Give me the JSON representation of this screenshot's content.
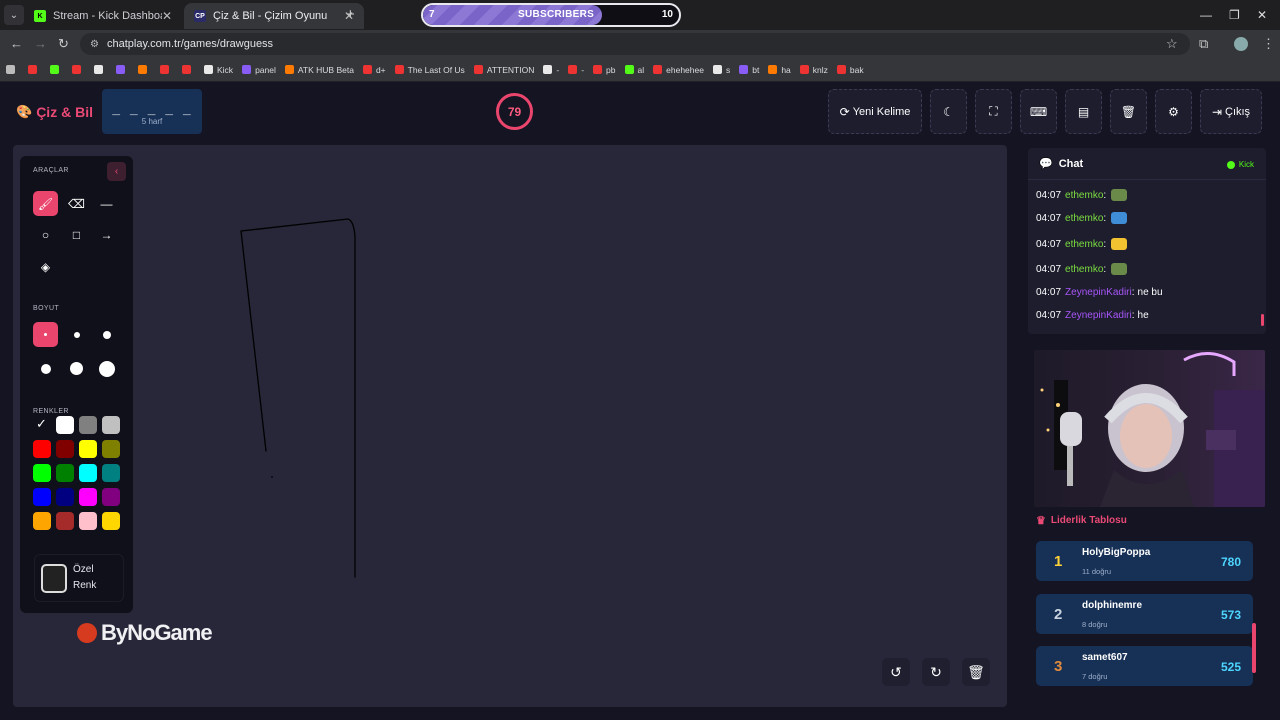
{
  "browser": {
    "tabs": [
      {
        "title": "Stream - Kick Dashboard",
        "active": false,
        "favicon": "kick-icon"
      },
      {
        "title": "Çiz & Bil - Çizim Oyunu",
        "active": true,
        "favicon": "chatplay-icon"
      }
    ],
    "subscribers_goal": {
      "label": "SUBSCRIBERS",
      "current": "7",
      "goal": "10",
      "progress_fraction": 0.7
    },
    "url": "chatplay.com.tr/games/drawguess",
    "bookmarks": [
      "Kick",
      "panel",
      "ATK HUB Beta",
      "d+",
      "The Last Of Us",
      "ATTENTION",
      "-",
      "-",
      "pb",
      "al",
      "ehehehee",
      "s",
      "bt",
      "ha",
      "knlz",
      "bak"
    ]
  },
  "app": {
    "title": "Çiz & Bil",
    "word": {
      "blanks": "_ _ _ _ _",
      "length_label": "5 harf"
    },
    "timer": "79",
    "top_buttons": {
      "new_word": "Yeni Kelime",
      "exit": "Çıkış"
    },
    "tools": {
      "section_tools": "ARAÇLAR",
      "section_size": "BOYUT",
      "section_colors": "RENKLER",
      "custom_color_label": "Özel Renk",
      "tool_names": [
        "brush-icon",
        "eraser-icon",
        "line-icon",
        "circle-icon",
        "square-icon",
        "arrow-icon",
        "fill-bucket-icon"
      ],
      "colors": [
        "#000000",
        "#ffffff",
        "#808080",
        "#c0c0c0",
        "#ff0000",
        "#800000",
        "#ffff00",
        "#808000",
        "#00ff00",
        "#008000",
        "#00ffff",
        "#008080",
        "#0000ff",
        "#000080",
        "#ff00ff",
        "#800080",
        "#ffa500",
        "#a52a2a",
        "#ffc0cb",
        "#ffd700"
      ],
      "selected_color": "#000000"
    },
    "watermark": "ByNoGame"
  },
  "chat": {
    "title": "Chat",
    "platform": "Kick",
    "messages": [
      {
        "time": "04:07",
        "user": "ethemko",
        "text": "",
        "color": "#7dde3f",
        "emote": true
      },
      {
        "time": "04:07",
        "user": "ethemko",
        "text": "",
        "color": "#7dde3f",
        "emote": true
      },
      {
        "time": "04:07",
        "user": "ethemko",
        "text": "",
        "color": "#7dde3f",
        "emote": true
      },
      {
        "time": "04:07",
        "user": "ethemko",
        "text": "",
        "color": "#7dde3f",
        "emote": true
      },
      {
        "time": "04:07",
        "user": "ZeynepinKadiri",
        "text": "ne bu",
        "color": "#a855f7",
        "emote": false
      },
      {
        "time": "04:07",
        "user": "ZeynepinKadiri",
        "text": "he",
        "color": "#a855f7",
        "emote": false
      }
    ]
  },
  "leaderboard": {
    "title": "Liderlik Tablosu",
    "rows": [
      {
        "rank": "1",
        "name": "HolyBigPoppa",
        "correct": "11 doğru",
        "score": "780",
        "rank_color": "#ffd23a"
      },
      {
        "rank": "2",
        "name": "dolphinemre",
        "correct": "8 doğru",
        "score": "573",
        "rank_color": "#c9d3e0"
      },
      {
        "rank": "3",
        "name": "samet607",
        "correct": "7 doğru",
        "score": "525",
        "rank_color": "#e08a3c"
      }
    ]
  }
}
